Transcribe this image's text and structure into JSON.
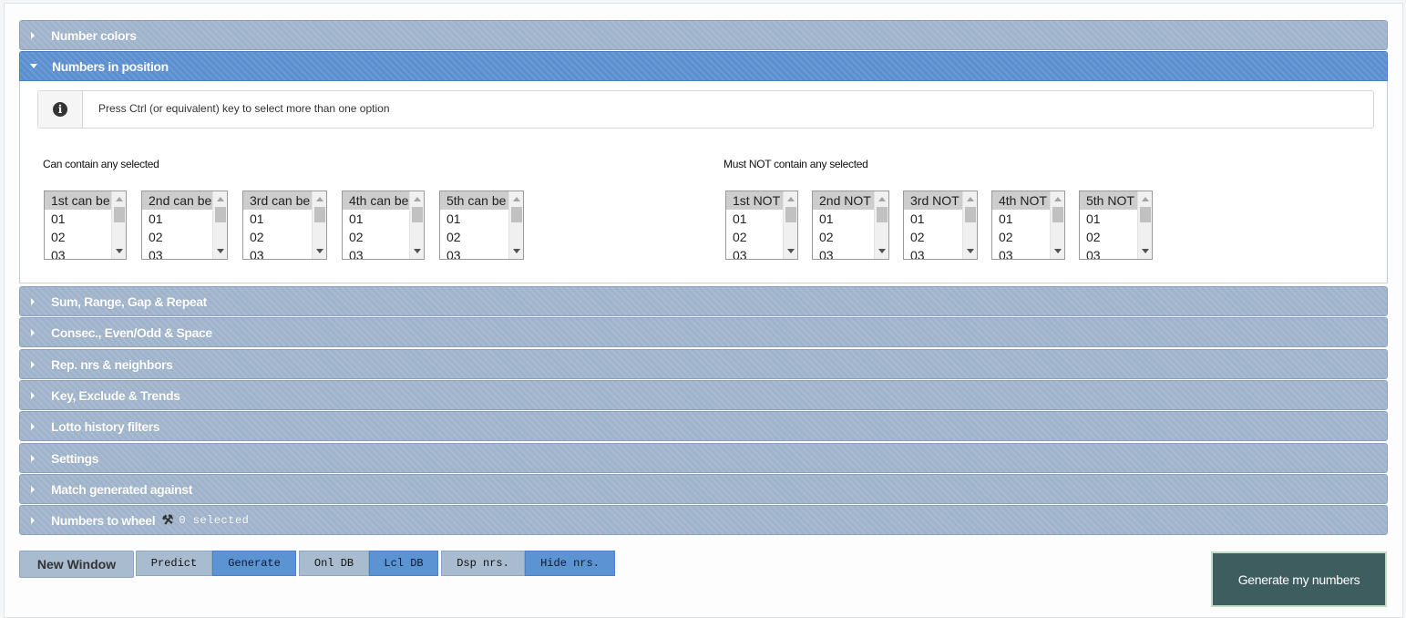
{
  "accordion": {
    "number_colors": "Number colors",
    "numbers_in_position": "Numbers in position",
    "sum_range": "Sum, Range, Gap & Repeat",
    "consec": "Consec., Even/Odd & Space",
    "rep_nrs": "Rep. nrs & neighbors",
    "key_exclude": "Key, Exclude & Trends",
    "lotto_history": "Lotto history filters",
    "settings": "Settings",
    "match_generated": "Match generated against",
    "numbers_to_wheel": "Numbers to wheel",
    "wheel_count": "0 selected"
  },
  "info": {
    "icon": "info-circle-icon",
    "text": "Press Ctrl (or equivalent) key to select more than one option"
  },
  "can_contain": {
    "label": "Can contain any selected",
    "lists": [
      {
        "header": "1st can be",
        "options": [
          "01",
          "02",
          "03"
        ]
      },
      {
        "header": "2nd can be",
        "options": [
          "01",
          "02",
          "03"
        ]
      },
      {
        "header": "3rd can be",
        "options": [
          "01",
          "02",
          "03"
        ]
      },
      {
        "header": "4th can be",
        "options": [
          "01",
          "02",
          "03"
        ]
      },
      {
        "header": "5th can be",
        "options": [
          "01",
          "02",
          "03"
        ]
      }
    ]
  },
  "must_not": {
    "label": "Must NOT contain any selected",
    "lists": [
      {
        "header": "1st NOT",
        "options": [
          "01",
          "02",
          "03"
        ]
      },
      {
        "header": "2nd NOT",
        "options": [
          "01",
          "02",
          "03"
        ]
      },
      {
        "header": "3rd NOT",
        "options": [
          "01",
          "02",
          "03"
        ]
      },
      {
        "header": "4th NOT",
        "options": [
          "01",
          "02",
          "03"
        ]
      },
      {
        "header": "5th NOT",
        "options": [
          "01",
          "02",
          "03"
        ]
      }
    ]
  },
  "buttons": {
    "new_window": "New Window",
    "predict": "Predict",
    "generate": "Generate",
    "onl_db": "Onl DB",
    "lcl_db": "Lcl DB",
    "dsp_nrs": "Dsp nrs.",
    "hide_nrs": "Hide nrs.",
    "generate_my_numbers": "Generate my numbers"
  }
}
